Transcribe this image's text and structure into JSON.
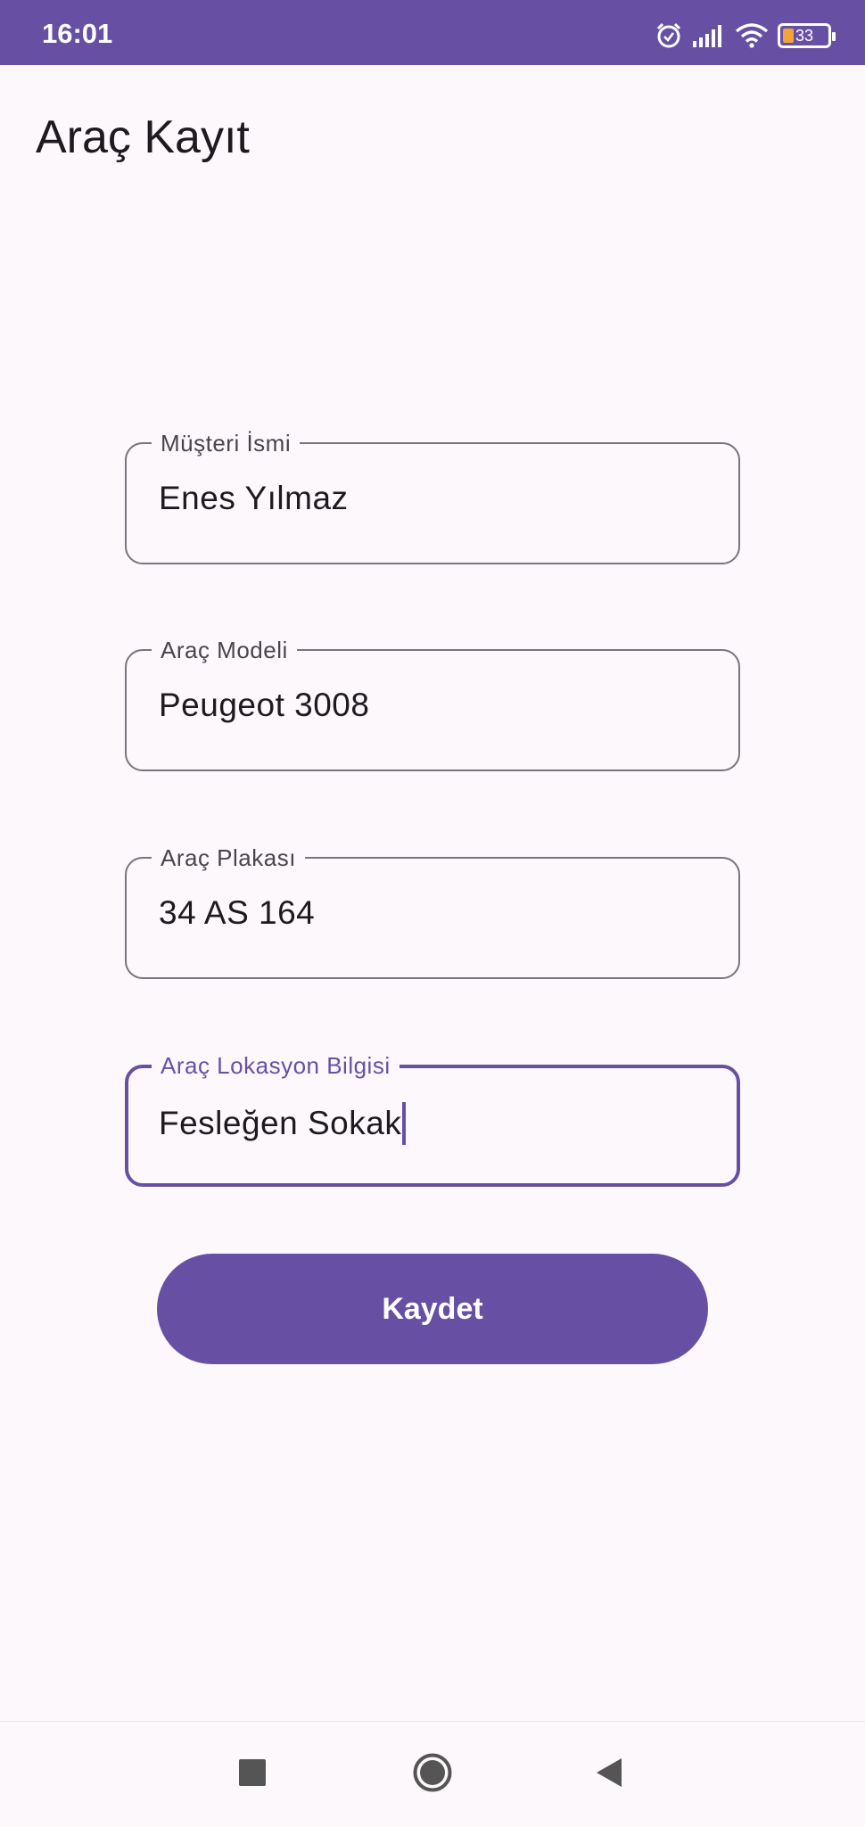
{
  "status_bar": {
    "time": "16:01",
    "battery_level": "33",
    "icons": [
      "alarm-icon",
      "signal-icon",
      "wifi-icon",
      "battery-icon"
    ]
  },
  "page": {
    "title": "Araç Kayıt"
  },
  "form": {
    "fields": [
      {
        "label": "Müşteri İsmi",
        "value": "Enes Yılmaz"
      },
      {
        "label": "Araç Modeli",
        "value": "Peugeot 3008"
      },
      {
        "label": "Araç Plakası",
        "value": "34 AS 164"
      },
      {
        "label": "Araç Lokasyon Bilgisi",
        "value": "Fesleğen Sokak"
      }
    ],
    "save_label": "Kaydet"
  },
  "nav_bar": {
    "icons": [
      "recents-icon",
      "home-icon",
      "back-icon"
    ]
  },
  "colors": {
    "primary": "#6750a4",
    "background": "#fdf8fc",
    "outline": "#79747e",
    "text": "#1d1b20"
  }
}
